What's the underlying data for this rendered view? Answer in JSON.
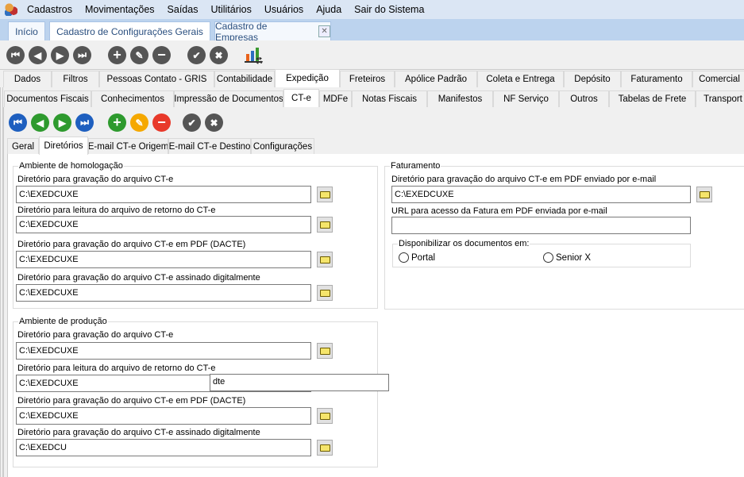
{
  "menu": {
    "items": [
      "Cadastros",
      "Movimentações",
      "Saídas",
      "Utilitários",
      "Usuários",
      "Ajuda",
      "Sair do Sistema"
    ]
  },
  "doc_tabs": [
    "Início",
    "Cadastro de Configurações Gerais",
    "Cadastro de Empresas"
  ],
  "main_tabs": [
    "Dados",
    "Filtros",
    "Pessoas Contato - GRIS",
    "Contabilidade",
    "Expedição",
    "Freteiros",
    "Apólice Padrão",
    "Coleta e Entrega",
    "Depósito",
    "Faturamento",
    "Comercial"
  ],
  "sub_tabs": [
    "Documentos Fiscais",
    "Conhecimentos",
    "Impressão de Documentos",
    "CT-e",
    "MDFe",
    "Notas Fiscais",
    "Manifestos",
    "NF Serviço",
    "Outros",
    "Tabelas de Frete",
    "Transport"
  ],
  "cte_tabs": [
    "Geral",
    "Diretórios",
    "E-mail CT-e Origem",
    "E-mail CT-e Destino",
    "Configurações"
  ],
  "homologacao": {
    "title": "Ambiente de homologação",
    "fields": [
      {
        "label": "Diretório para gravação do arquivo CT-e",
        "value": "C:\\EXEDCUXE"
      },
      {
        "label": "Diretório para leitura do arquivo de retorno do CT-e",
        "value": "C:\\EXEDCUXE"
      },
      {
        "label": "Diretório para gravação do arquivo CT-e em PDF (DACTE)",
        "value": "C:\\EXEDCUXE"
      },
      {
        "label": "Diretório para gravação do arquivo CT-e assinado digitalmente",
        "value": "C:\\EXEDCUXE"
      }
    ]
  },
  "producao": {
    "title": "Ambiente de produção",
    "fields": [
      {
        "label": "Diretório para gravação do arquivo CT-e",
        "value": "C:\\EXEDCUXE"
      },
      {
        "label": "Diretório para leitura do arquivo de retorno do CT-e",
        "value": "C:\\EXEDCUXE"
      },
      {
        "label": "Diretório para gravação do arquivo CT-e em PDF (DACTE)",
        "value": "C:\\EXEDCUXE"
      },
      {
        "label": "Diretório para gravação do arquivo CT-e assinado digitalmente",
        "value": "C:\\EXEDCU"
      }
    ]
  },
  "faturamento": {
    "title": "Faturamento",
    "pdf_label": "Diretório para gravação do arquivo CT-e em PDF enviado por e-mail",
    "pdf_value": "C:\\EXEDCUXE",
    "url_label": "URL para acesso da Fatura em PDF enviada por e-mail",
    "url_value": "",
    "disp_title": "Disponibilizar os documentos em:",
    "options": [
      "Portal",
      "Senior X"
    ]
  },
  "autocomplete": {
    "text": "dte"
  }
}
